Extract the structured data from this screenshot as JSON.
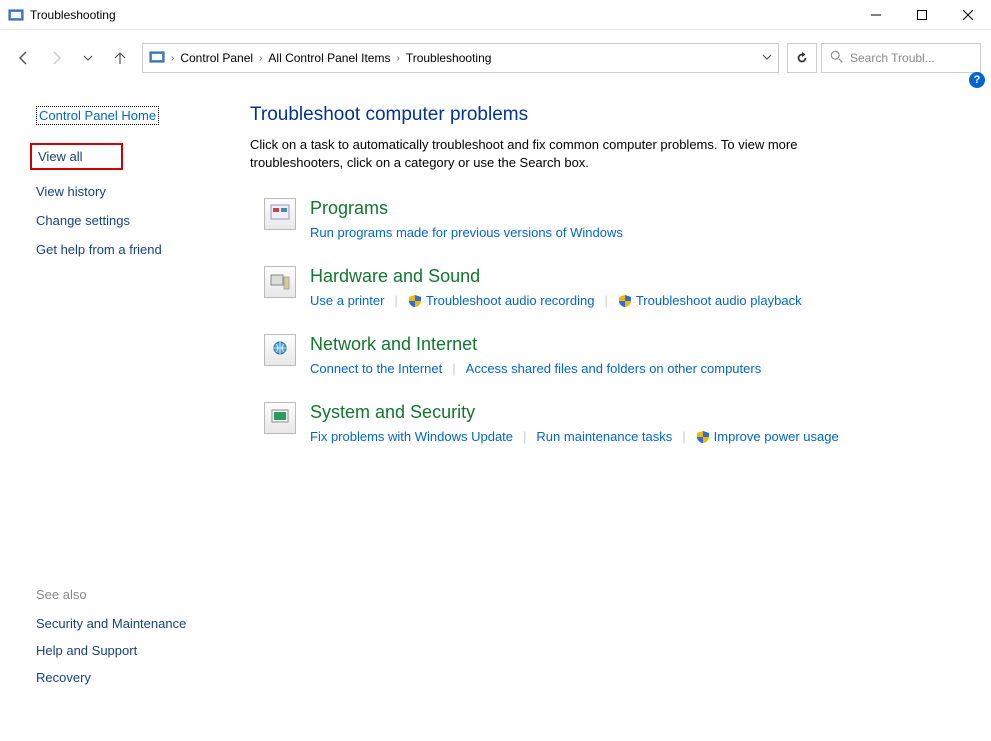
{
  "window": {
    "title": "Troubleshooting"
  },
  "breadcrumb": {
    "seg1": "Control Panel",
    "seg2": "All Control Panel Items",
    "seg3": "Troubleshooting"
  },
  "search": {
    "placeholder": "Search Troubl..."
  },
  "sidebar": {
    "home": "Control Panel Home",
    "links": {
      "view_all": "View all",
      "view_history": "View history",
      "change_settings": "Change settings",
      "get_help": "Get help from a friend"
    }
  },
  "seealso": {
    "header": "See also",
    "security": "Security and Maintenance",
    "help": "Help and Support",
    "recovery": "Recovery"
  },
  "main": {
    "heading": "Troubleshoot computer problems",
    "description": "Click on a task to automatically troubleshoot and fix common computer problems. To view more troubleshooters, click on a category or use the Search box.",
    "categories": {
      "programs": {
        "title": "Programs",
        "link1": "Run programs made for previous versions of Windows"
      },
      "hardware": {
        "title": "Hardware and Sound",
        "link1": "Use a printer",
        "link2": "Troubleshoot audio recording",
        "link3": "Troubleshoot audio playback"
      },
      "network": {
        "title": "Network and Internet",
        "link1": "Connect to the Internet",
        "link2": "Access shared files and folders on other computers"
      },
      "system": {
        "title": "System and Security",
        "link1": "Fix problems with Windows Update",
        "link2": "Run maintenance tasks",
        "link3": "Improve power usage"
      }
    }
  }
}
